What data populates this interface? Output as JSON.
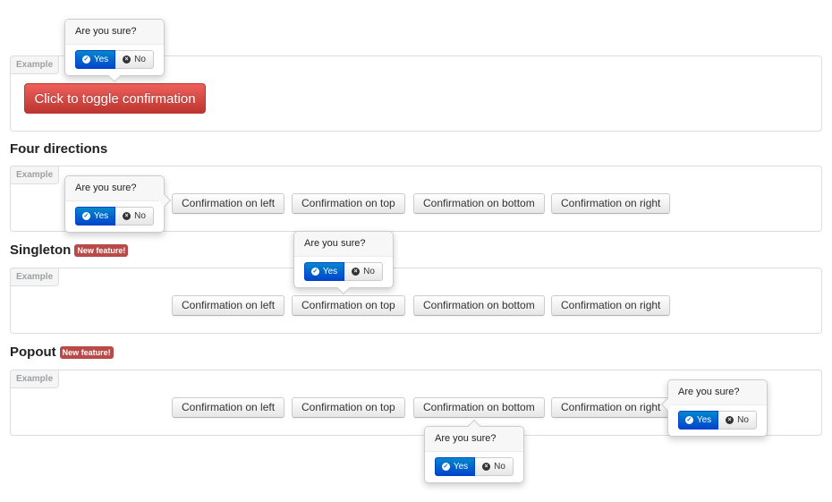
{
  "example_label": "Example",
  "intro": {
    "toggle_button": "Click to toggle confirmation"
  },
  "sections": [
    {
      "title": "Four directions"
    },
    {
      "title": "Singleton",
      "badge": "New feature!"
    },
    {
      "title": "Popout",
      "badge": "New feature!"
    }
  ],
  "buttons": {
    "left": "Confirmation on left",
    "top": "Confirmation on top",
    "bottom": "Confirmation on bottom",
    "right": "Confirmation on right"
  },
  "confirm": {
    "title": "Are you sure?",
    "yes": "Yes",
    "no": "No",
    "yes_icon": "check-circle-icon",
    "no_icon": "x-circle-icon"
  },
  "colors": {
    "danger": "#da4f49",
    "primary": "#0055cc",
    "badge": "#b94a48"
  }
}
